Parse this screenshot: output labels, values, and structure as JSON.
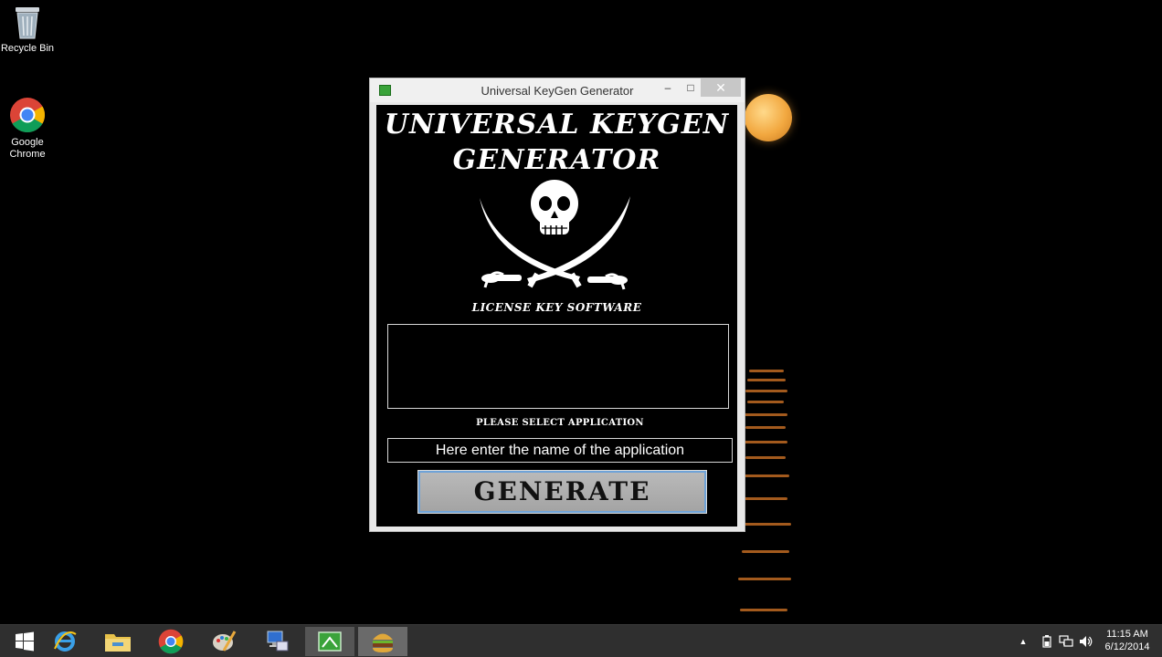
{
  "desktop": {
    "icons": [
      {
        "label": "Recycle Bin",
        "icon": "recycle-bin-icon"
      },
      {
        "label": "Google\nChrome",
        "icon": "chrome-icon"
      }
    ]
  },
  "window": {
    "title": "Universal KeyGen Generator",
    "controls": {
      "minimize": "–",
      "maximize": "□",
      "close": "✕"
    },
    "heading_line1": "UNIVERSAL KEYGEN",
    "heading_line2": "GENERATOR",
    "logo_icon": "skull-crossed-swords-icon",
    "tagline": "LICENSE KEY SOFTWARE",
    "output_value": "",
    "select_label": "PLEASE SELECT APPLICATION",
    "input_placeholder": "Here enter the name of the application",
    "generate_label": "GENERATE"
  },
  "taskbar": {
    "items": [
      {
        "name": "start-button",
        "icon": "windows-logo-icon"
      },
      {
        "name": "internet-explorer",
        "icon": "ie-icon"
      },
      {
        "name": "file-explorer",
        "icon": "folder-icon"
      },
      {
        "name": "chrome",
        "icon": "chrome-icon"
      },
      {
        "name": "paint",
        "icon": "paint-icon"
      },
      {
        "name": "remote-desktop",
        "icon": "computer-icon"
      },
      {
        "name": "keygen-app",
        "icon": "keygen-app-icon"
      },
      {
        "name": "burger-app",
        "icon": "burger-icon"
      }
    ],
    "tray": {
      "expand": "▲",
      "time": "11:15 AM",
      "date": "6/12/2014"
    }
  },
  "colors": {
    "accent": "#6fa3d8",
    "window_bg": "#000000",
    "moon": "#f2a840"
  }
}
